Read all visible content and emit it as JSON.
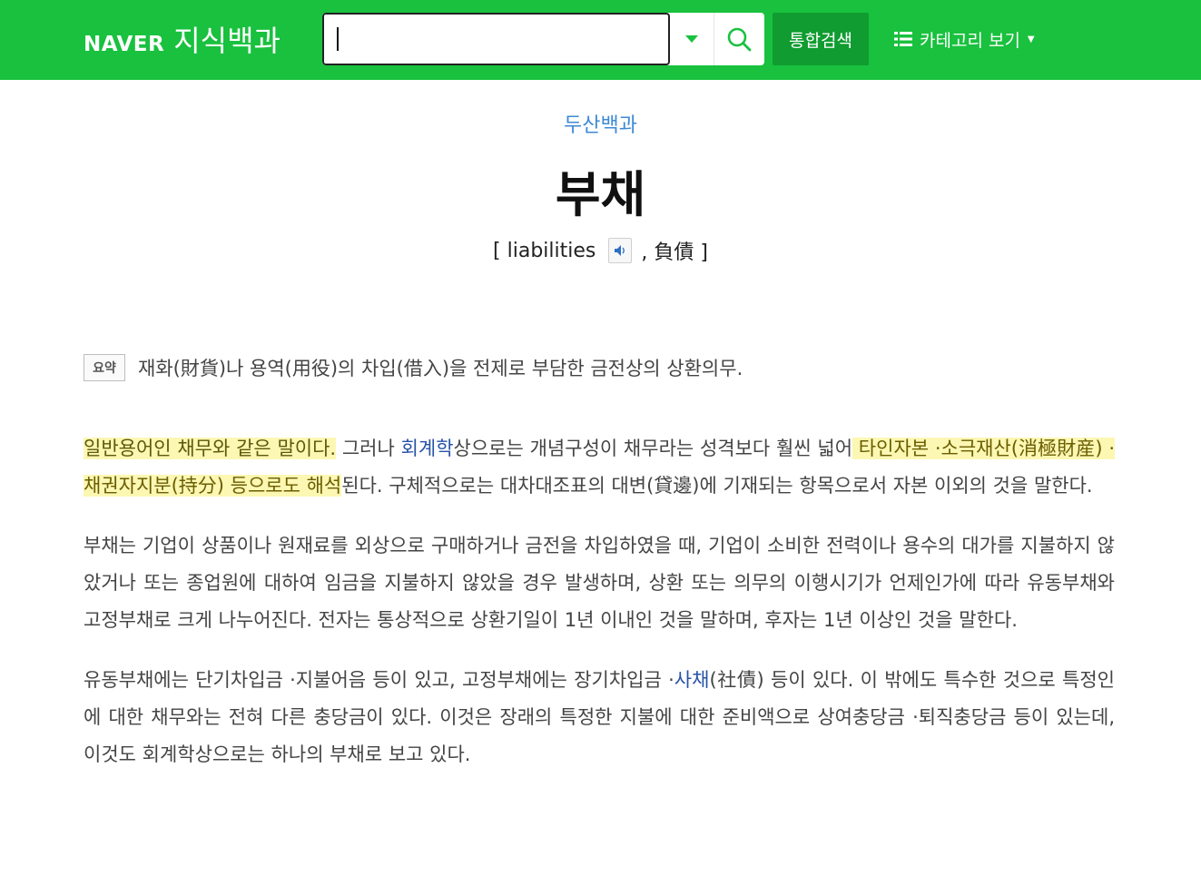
{
  "header": {
    "logo_brand": "NAVER",
    "logo_service": "지식백과",
    "search": {
      "value": "",
      "placeholder": ""
    },
    "total_search_label": "통합검색",
    "category_label": "카테고리 보기",
    "accent_color": "#19c13e"
  },
  "article": {
    "source": "두산백과",
    "title": "부채",
    "subtitle_open": "[ liabilities",
    "subtitle_hanja": ", 負債 ]",
    "summary_badge": "요약",
    "summary_text": "재화(財貨)나 용역(用役)의 차입(借入)을 전제로 부담한 금전상의 상환의무.",
    "p1": {
      "hl1": "일반용어인 채무와 같은 말이다.",
      "t1": " 그러나 ",
      "link1": "회계학",
      "t2": "상으로는 개념구성이 채무라는 성격보다 훨씬 넓어",
      "hl2": " 타인자본 ·소극재산(消極財産) ·채권자지분(持分) 등으로도 해석",
      "t3": "된다. 구체적으로는 대차대조표의 대변(貸邊)에 기재되는 항목으로서 자본 이외의 것을 말한다."
    },
    "p2": "부채는 기업이 상품이나 원재료를 외상으로 구매하거나 금전을 차입하였을 때, 기업이 소비한 전력이나 용수의 대가를 지불하지 않았거나 또는 종업원에 대하여 임금을 지불하지 않았을 경우 발생하며, 상환 또는 의무의 이행시기가 언제인가에 따라 유동부채와 고정부채로 크게 나누어진다. 전자는 통상적으로 상환기일이 1년 이내인 것을 말하며, 후자는 1년 이상인 것을 말한다.",
    "p3": {
      "t1": "유동부채에는 단기차입금 ·지불어음 등이 있고, 고정부채에는 장기차입금 ·",
      "link1": "사채",
      "t2": "(社債) 등이 있다. 이 밖에도 특수한 것으로 특정인에 대한 채무와는 전혀 다른 충당금이 있다. 이것은 장래의 특정한 지불에 대한 준비액으로 상여충당금 ·퇴직충당금 등이 있는데, 이것도 회계학상으로는 하나의 부채로 보고 있다."
    }
  }
}
